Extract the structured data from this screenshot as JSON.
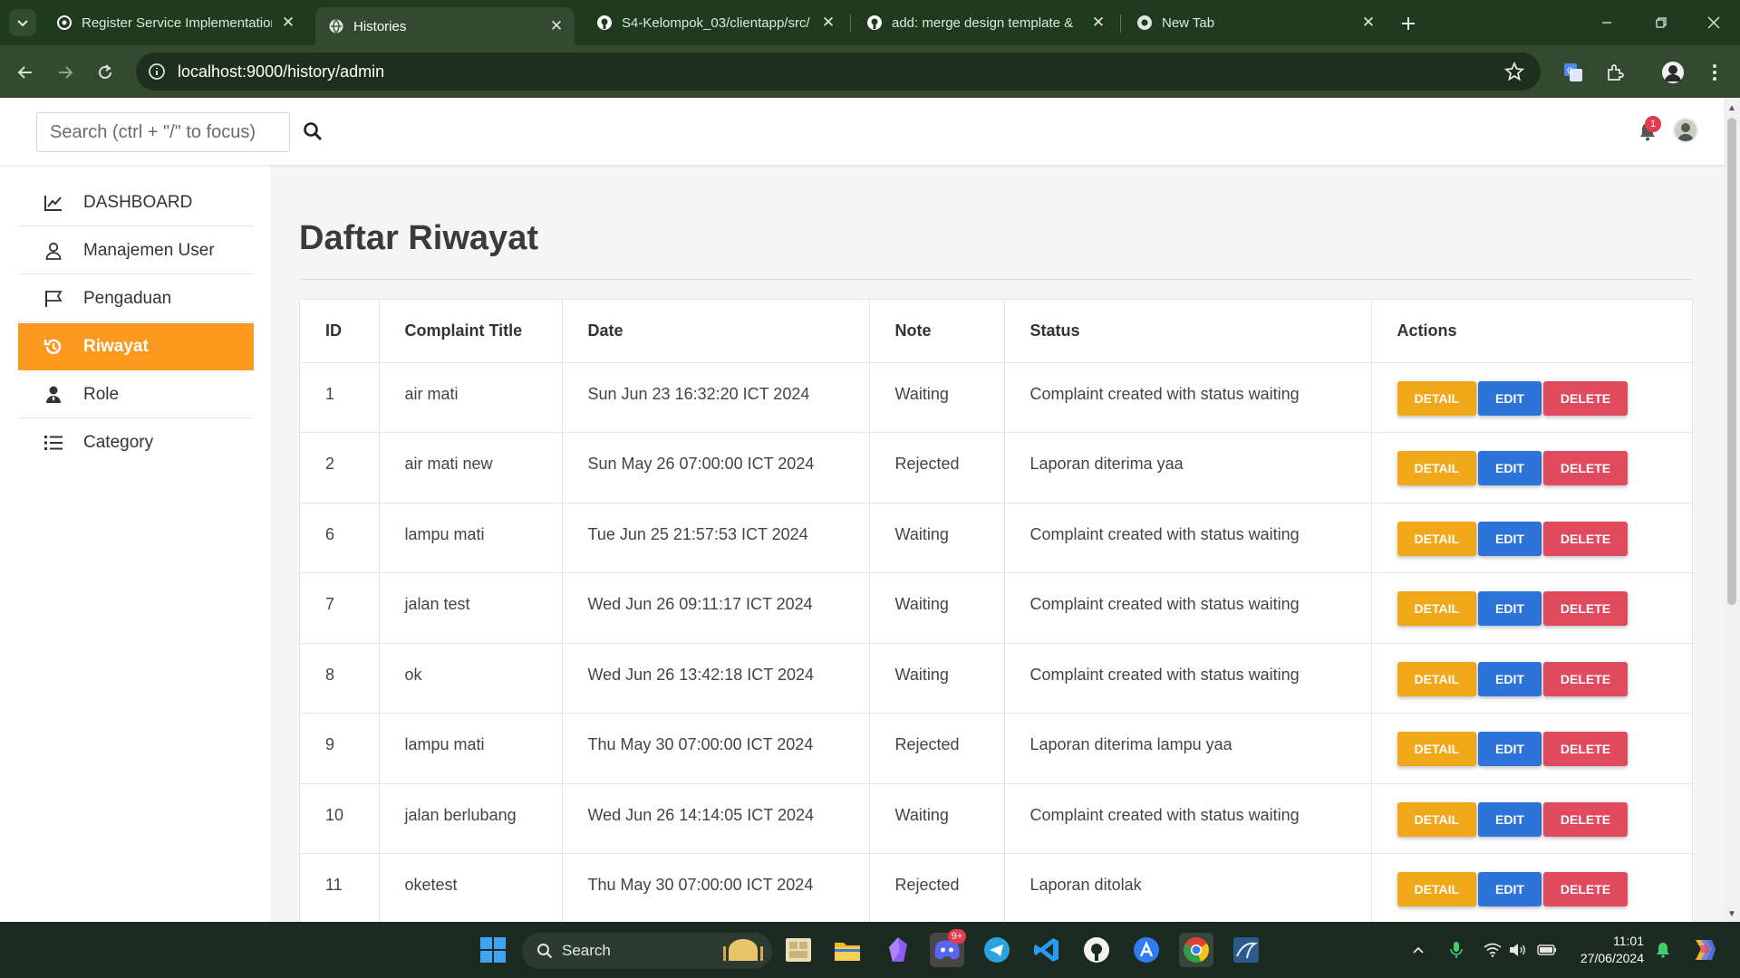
{
  "browser": {
    "tabs": [
      {
        "title": "Register Service Implementation",
        "active": false
      },
      {
        "title": "Histories",
        "active": true
      },
      {
        "title": "S4-Kelompok_03/clientapp/src/",
        "active": false
      },
      {
        "title": "add: merge design template &",
        "active": false
      },
      {
        "title": "New Tab",
        "active": false
      }
    ],
    "url": "localhost:9000/history/admin"
  },
  "topnav": {
    "search_placeholder": "Search (ctrl + \"/\" to focus)",
    "notification_count": "1"
  },
  "sidebar": {
    "items": [
      {
        "label": "DASHBOARD",
        "icon": "chart-line-icon",
        "active": false
      },
      {
        "label": "Manajemen User",
        "icon": "user-icon",
        "active": false
      },
      {
        "label": "Pengaduan",
        "icon": "flag-icon",
        "active": false
      },
      {
        "label": "Riwayat",
        "icon": "history-icon",
        "active": true
      },
      {
        "label": "Role",
        "icon": "user-tie-icon",
        "active": false
      },
      {
        "label": "Category",
        "icon": "list-icon",
        "active": false
      }
    ]
  },
  "main": {
    "title": "Daftar Riwayat",
    "table": {
      "headers": [
        "ID",
        "Complaint Title",
        "Date",
        "Note",
        "Status",
        "Actions"
      ],
      "rows": [
        {
          "id": "1",
          "title": "air mati",
          "date": "Sun Jun 23 16:32:20 ICT 2024",
          "note": "Waiting",
          "status": "Complaint created with status waiting"
        },
        {
          "id": "2",
          "title": "air mati new",
          "date": "Sun May 26 07:00:00 ICT 2024",
          "note": "Rejected",
          "status": "Laporan diterima yaa"
        },
        {
          "id": "6",
          "title": "lampu mati",
          "date": "Tue Jun 25 21:57:53 ICT 2024",
          "note": "Waiting",
          "status": "Complaint created with status waiting"
        },
        {
          "id": "7",
          "title": "jalan test",
          "date": "Wed Jun 26 09:11:17 ICT 2024",
          "note": "Waiting",
          "status": "Complaint created with status waiting"
        },
        {
          "id": "8",
          "title": "ok",
          "date": "Wed Jun 26 13:42:18 ICT 2024",
          "note": "Waiting",
          "status": "Complaint created with status waiting"
        },
        {
          "id": "9",
          "title": "lampu mati",
          "date": "Thu May 30 07:00:00 ICT 2024",
          "note": "Rejected",
          "status": "Laporan diterima lampu yaa"
        },
        {
          "id": "10",
          "title": "jalan berlubang",
          "date": "Wed Jun 26 14:14:05 ICT 2024",
          "note": "Waiting",
          "status": "Complaint created with status waiting"
        },
        {
          "id": "11",
          "title": "oketest",
          "date": "Thu May 30 07:00:00 ICT 2024",
          "note": "Rejected",
          "status": "Laporan ditolak"
        }
      ],
      "actions": {
        "detail": "DETAIL",
        "edit": "EDIT",
        "delete": "DELETE"
      }
    }
  },
  "taskbar": {
    "search_label": "Search",
    "discord_badge": "9+",
    "time": "11:01",
    "date": "27/06/2024"
  },
  "colors": {
    "accent": "#fb991f",
    "detail": "#f0a818",
    "edit": "#2d73d9",
    "delete": "#e04a5f",
    "chrome": "#334a31"
  }
}
